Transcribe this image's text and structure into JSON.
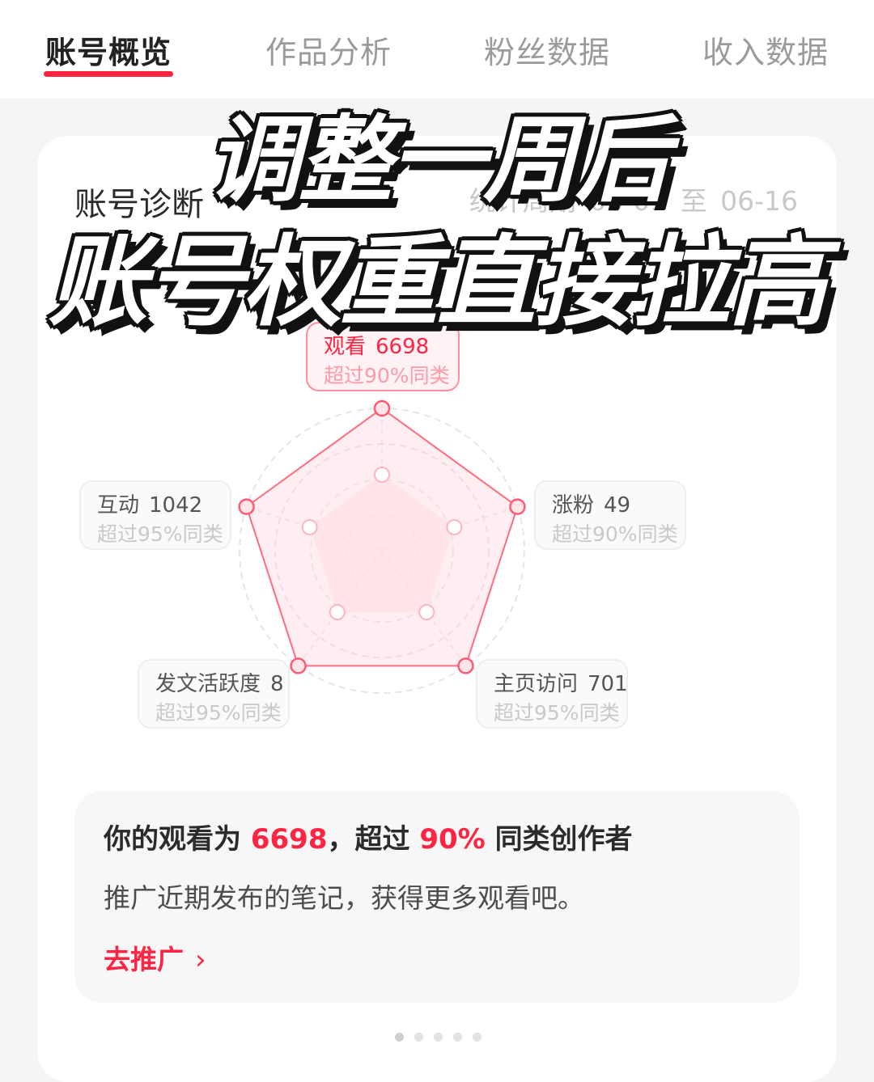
{
  "tabs": [
    {
      "label": "账号概览",
      "active": true
    },
    {
      "label": "作品分析",
      "active": false
    },
    {
      "label": "粉丝数据",
      "active": false
    },
    {
      "label": "收入数据",
      "active": false
    }
  ],
  "overlay": {
    "line1": "调整一周后",
    "line2": "账号权重直接拉高"
  },
  "card": {
    "title": "账号诊断",
    "period_label": "统计周期",
    "period_start": "06-09",
    "period_sep": "至",
    "period_end": "06-16"
  },
  "metrics": {
    "views": {
      "label": "观看",
      "value": "6698",
      "sub": "超过90%同类",
      "level": 1.0
    },
    "fans": {
      "label": "涨粉",
      "value": "49",
      "sub": "超过90%同类",
      "level": 1.0
    },
    "homepage": {
      "label": "主页访问",
      "value": "701",
      "sub": "超过95%同类",
      "level": 1.0
    },
    "activity": {
      "label": "发文活跃度",
      "value": "8",
      "sub": "超过95%同类",
      "level": 1.0
    },
    "interaction": {
      "label": "互动",
      "value": "1042",
      "sub": "超过95%同类",
      "level": 1.0
    }
  },
  "tip": {
    "prefix": "你的观看为",
    "value": "6698",
    "middle": "，超过",
    "percent": "90%",
    "suffix": "同类创作者",
    "line2": "推广近期发布的笔记，获得更多观看吧。",
    "action": "去推广",
    "action_icon": "chevron-right-icon"
  },
  "pager": {
    "count": 5,
    "active": 0
  },
  "colors": {
    "accent": "#ff2442",
    "radar_fill": "#ffe3e7",
    "tab_inactive": "#9b9b9b"
  }
}
